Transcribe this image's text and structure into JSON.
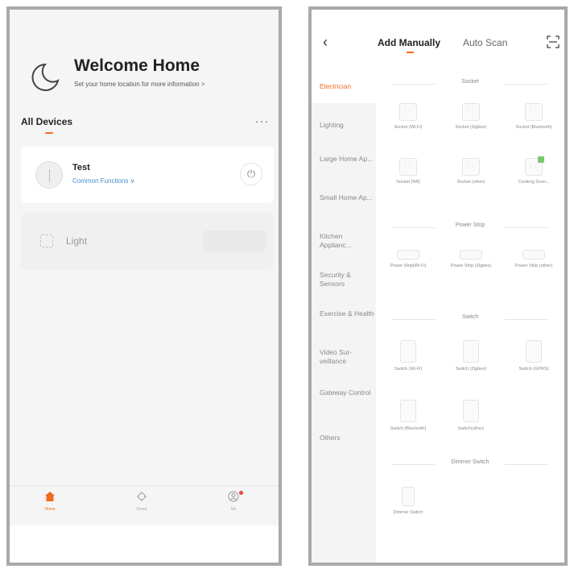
{
  "home": {
    "title": "Welcome Home",
    "subtitle": "Set your home location for more information >",
    "devices_title": "All Devices",
    "more": "···",
    "devices": [
      {
        "name": "Test",
        "link": "Common Functions ∨",
        "power": "⏻"
      },
      {
        "name": "Light"
      }
    ],
    "tabs": [
      {
        "label": "Home"
      },
      {
        "label": "Smart"
      },
      {
        "label": "Me"
      }
    ],
    "accent": "#f26b1d"
  },
  "add": {
    "back": "‹",
    "tab_manual": "Add Manually",
    "tab_auto": "Auto Scan",
    "categories": [
      "Electrician",
      "Lighting",
      "Large Home Ap...",
      "Small Home Ap...",
      "Kitchen Applianc...",
      "Security & Sensors",
      "Exercise & Health",
      "Video Sur-veillance",
      "Gateway Control",
      "Others"
    ],
    "sections": [
      {
        "title": "Socket",
        "items": [
          "Socket (Wi-Fi)",
          "Socket (Zigbee)",
          "Socket (Bluetooth)",
          "Socket (NB)",
          "Socket (other)",
          "Cooking Scen..."
        ]
      },
      {
        "title": "Power Strip",
        "items": [
          "Power Strip(Wi-Fi)",
          "Power Strip (Zigbee)",
          "Power Strip (other)"
        ]
      },
      {
        "title": "Switch",
        "items": [
          "Switch (Wi-Fi)",
          "Switch (Zigbee)",
          "Switch (GPRS)",
          "Switch (Bluetooth)",
          "Switch(other)"
        ]
      },
      {
        "title": "Dimmer Switch",
        "items": [
          "Dimmer Switch"
        ]
      }
    ]
  }
}
